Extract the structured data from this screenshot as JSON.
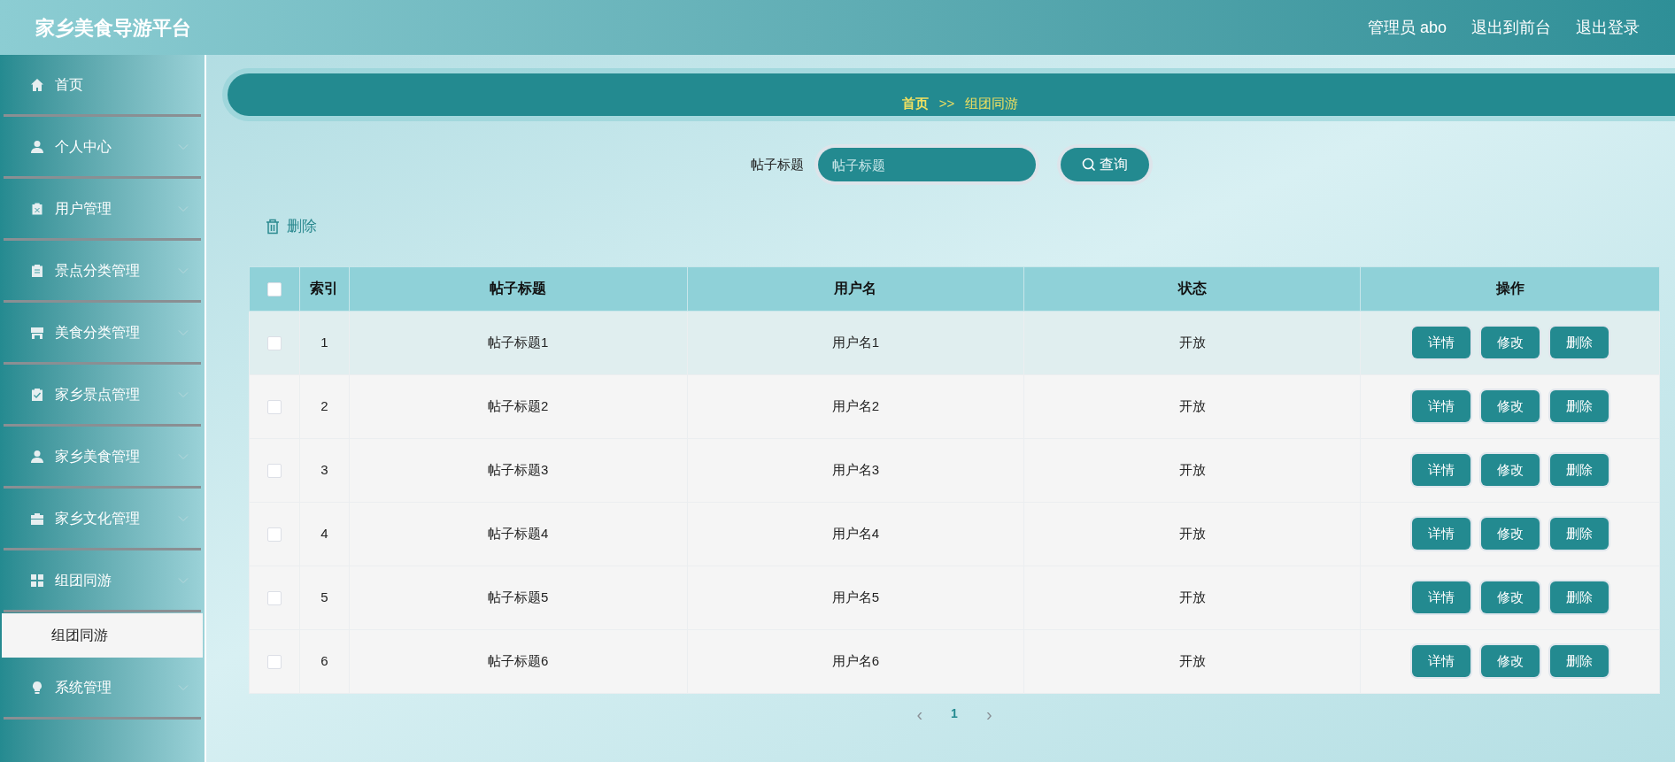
{
  "header": {
    "title": "家乡美食导游平台",
    "links": [
      "管理员 abo",
      "退出到前台",
      "退出登录"
    ]
  },
  "sidebar": {
    "items": [
      {
        "label": "首页",
        "kind": "link"
      },
      {
        "label": "个人中心",
        "kind": "menu"
      },
      {
        "label": "用户管理",
        "kind": "menu"
      },
      {
        "label": "景点分类管理",
        "kind": "menu"
      },
      {
        "label": "美食分类管理",
        "kind": "menu"
      },
      {
        "label": "家乡景点管理",
        "kind": "menu"
      },
      {
        "label": "家乡美食管理",
        "kind": "menu"
      },
      {
        "label": "家乡文化管理",
        "kind": "menu"
      },
      {
        "label": "组团同游",
        "kind": "menu",
        "children": [
          {
            "label": "组团同游",
            "selected": true
          }
        ]
      },
      {
        "label": "系统管理",
        "kind": "menu"
      }
    ]
  },
  "breadcrumb": [
    "首页",
    ">>",
    "组团同游"
  ],
  "search": {
    "label": "帖子标题",
    "placeholder": "帖子标题",
    "button": "查询"
  },
  "delete_button": "删除",
  "table": {
    "header_checked": false,
    "columns": [
      "索引",
      "帖子标题",
      "用户名",
      "状态",
      "操作"
    ],
    "rows": [
      {
        "checked": false,
        "hovered": true,
        "index": "1",
        "title": "帖子标题1",
        "user": "用户名1",
        "status": "开放",
        "actions": [
          "详情",
          "修改",
          "删除"
        ]
      },
      {
        "checked": false,
        "hovered": false,
        "index": "2",
        "title": "帖子标题2",
        "user": "用户名2",
        "status": "开放",
        "actions": [
          "详情",
          "修改",
          "删除"
        ]
      },
      {
        "checked": false,
        "hovered": false,
        "index": "3",
        "title": "帖子标题3",
        "user": "用户名3",
        "status": "开放",
        "actions": [
          "详情",
          "修改",
          "删除"
        ]
      },
      {
        "checked": false,
        "hovered": false,
        "index": "4",
        "title": "帖子标题4",
        "user": "用户名4",
        "status": "开放",
        "actions": [
          "详情",
          "修改",
          "删除"
        ]
      },
      {
        "checked": false,
        "hovered": false,
        "index": "5",
        "title": "帖子标题5",
        "user": "用户名5",
        "status": "开放",
        "actions": [
          "详情",
          "修改",
          "删除"
        ]
      },
      {
        "checked": false,
        "hovered": false,
        "index": "6",
        "title": "帖子标题6",
        "user": "用户名6",
        "status": "开放",
        "actions": [
          "详情",
          "修改",
          "删除"
        ]
      }
    ]
  },
  "pagination": {
    "previous": "‹",
    "next": "›",
    "pages": [
      {
        "label": "1",
        "selected": true
      }
    ]
  }
}
